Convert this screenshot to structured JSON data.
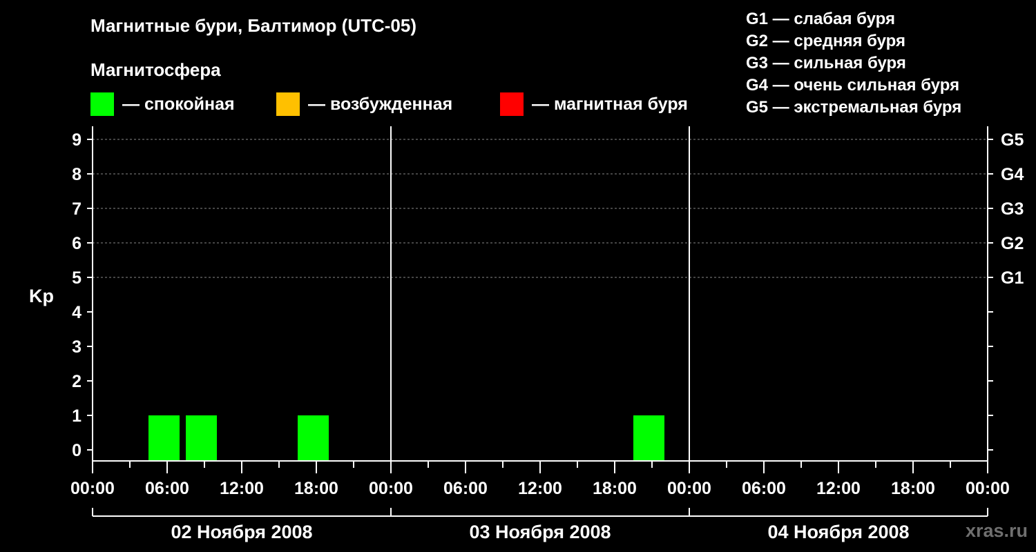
{
  "header": {
    "title": "Магнитные бури, Балтимор (UTC-05)",
    "subtitle": "Магнитосфера"
  },
  "legend": [
    {
      "label": "— спокойная",
      "color": "#00ff00"
    },
    {
      "label": "— возбужденная",
      "color": "#ffc000"
    },
    {
      "label": "— магнитная буря",
      "color": "#ff0000"
    }
  ],
  "storm_levels": [
    "G1 — слабая буря",
    "G2 — средняя буря",
    "G3 — сильная буря",
    "G4 — очень сильная буря",
    "G5 — экстремальная буря"
  ],
  "watermark": "xras.ru",
  "chart_data": {
    "type": "bar",
    "ylabel": "Kp",
    "ylim": [
      0,
      9
    ],
    "yticks": [
      "0",
      "1",
      "2",
      "3",
      "4",
      "5",
      "6",
      "7",
      "8",
      "9"
    ],
    "right_axis_labels": [
      {
        "kp": 5,
        "label": "G1"
      },
      {
        "kp": 6,
        "label": "G2"
      },
      {
        "kp": 7,
        "label": "G3"
      },
      {
        "kp": 8,
        "label": "G4"
      },
      {
        "kp": 9,
        "label": "G5"
      }
    ],
    "xlim_hours": [
      0,
      72
    ],
    "xticks": [
      "00:00",
      "06:00",
      "12:00",
      "18:00",
      "00:00",
      "06:00",
      "12:00",
      "18:00",
      "00:00",
      "06:00",
      "12:00",
      "18:00",
      "00:00"
    ],
    "days": [
      "02 Ноября 2008",
      "03 Ноября 2008",
      "04 Ноября 2008"
    ],
    "grid": "dashed at Kp 5-9",
    "bars": [
      {
        "start": "02 Ноября 2008 04:30",
        "end": "02 Ноября 2008 07:00",
        "kp": 1,
        "color": "#00ff00"
      },
      {
        "start": "02 Ноября 2008 07:30",
        "end": "02 Ноября 2008 10:00",
        "kp": 1,
        "color": "#00ff00"
      },
      {
        "start": "02 Ноября 2008 16:30",
        "end": "02 Ноября 2008 19:00",
        "kp": 1,
        "color": "#00ff00"
      },
      {
        "start": "03 Ноября 2008 19:30",
        "end": "03 Ноября 2008 22:00",
        "kp": 1,
        "color": "#00ff00"
      }
    ]
  }
}
